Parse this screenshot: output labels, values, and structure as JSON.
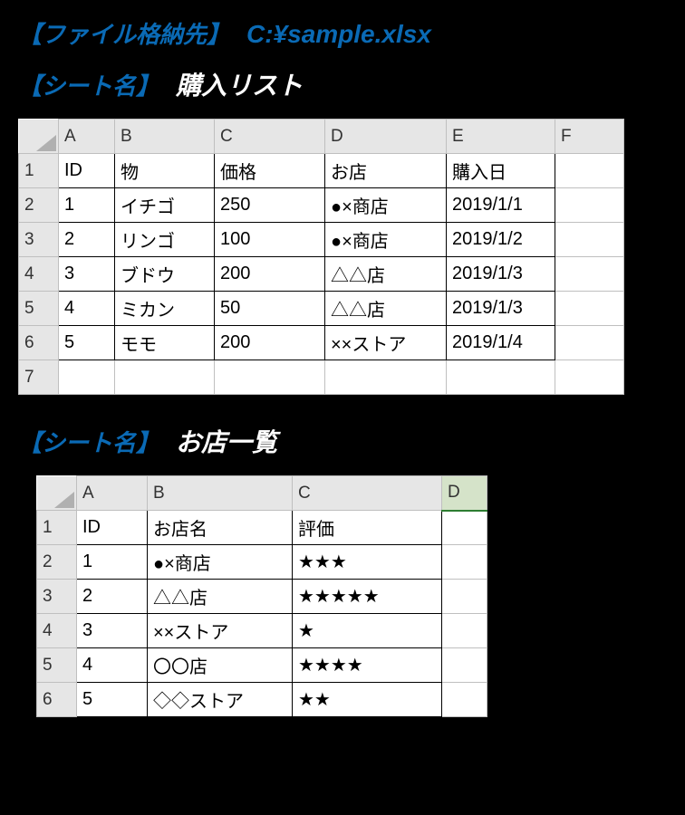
{
  "file_path": {
    "label": "【ファイル格納先】",
    "value": "C:¥sample.xlsx"
  },
  "sheet1": {
    "label": "【シート名】",
    "name": "購入リスト",
    "col_letters": [
      "A",
      "B",
      "C",
      "D",
      "E",
      "F"
    ],
    "row_numbers": [
      "1",
      "2",
      "3",
      "4",
      "5",
      "6",
      "7"
    ],
    "headers": [
      "ID",
      "物",
      "価格",
      "お店",
      "購入日"
    ],
    "rows": [
      {
        "id": "1",
        "item": "イチゴ",
        "price": "250",
        "store": "●×商店",
        "date": "2019/1/1"
      },
      {
        "id": "2",
        "item": "リンゴ",
        "price": "100",
        "store": "●×商店",
        "date": "2019/1/2"
      },
      {
        "id": "3",
        "item": "ブドウ",
        "price": "200",
        "store": "△△店",
        "date": "2019/1/3"
      },
      {
        "id": "4",
        "item": "ミカン",
        "price": "50",
        "store": "△△店",
        "date": "2019/1/3"
      },
      {
        "id": "5",
        "item": "モモ",
        "price": "200",
        "store": "××ストア",
        "date": "2019/1/4"
      }
    ]
  },
  "sheet2": {
    "label": "【シート名】",
    "name": "お店一覧",
    "col_letters": [
      "A",
      "B",
      "C",
      "D"
    ],
    "row_numbers": [
      "1",
      "2",
      "3",
      "4",
      "5",
      "6"
    ],
    "headers": [
      "ID",
      "お店名",
      "評価"
    ],
    "rows": [
      {
        "id": "1",
        "store": "●×商店",
        "rating": "★★★"
      },
      {
        "id": "2",
        "store": "△△店",
        "rating": "★★★★★"
      },
      {
        "id": "3",
        "store": "××ストア",
        "rating": "★"
      },
      {
        "id": "4",
        "store": "〇〇店",
        "rating": "★★★★"
      },
      {
        "id": "5",
        "store": "◇◇ストア",
        "rating": "★★"
      }
    ]
  }
}
